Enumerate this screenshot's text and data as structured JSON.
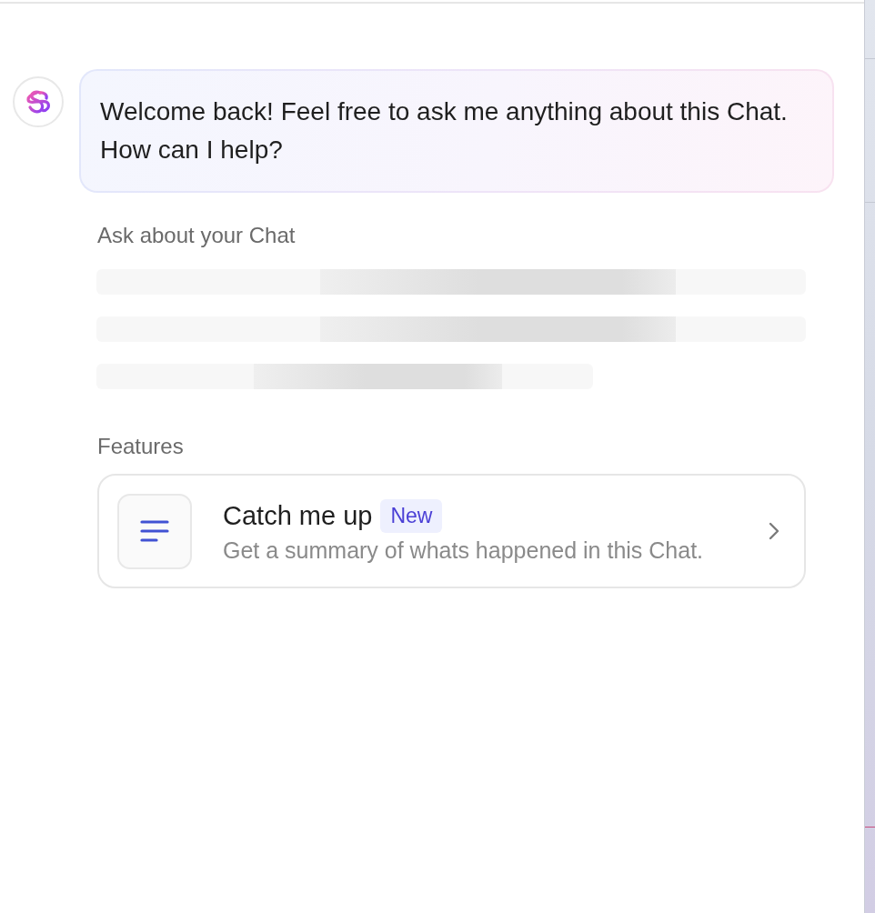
{
  "assistant": {
    "greeting": "Welcome back! Feel free to ask me anything about this Chat.\nHow can I help?"
  },
  "suggestions": {
    "heading": "Ask about your Chat",
    "loading": true
  },
  "features": {
    "heading": "Features",
    "items": [
      {
        "title": "Catch me up",
        "badge": "New",
        "description": "Get a summary of whats happened in this Chat."
      }
    ]
  }
}
